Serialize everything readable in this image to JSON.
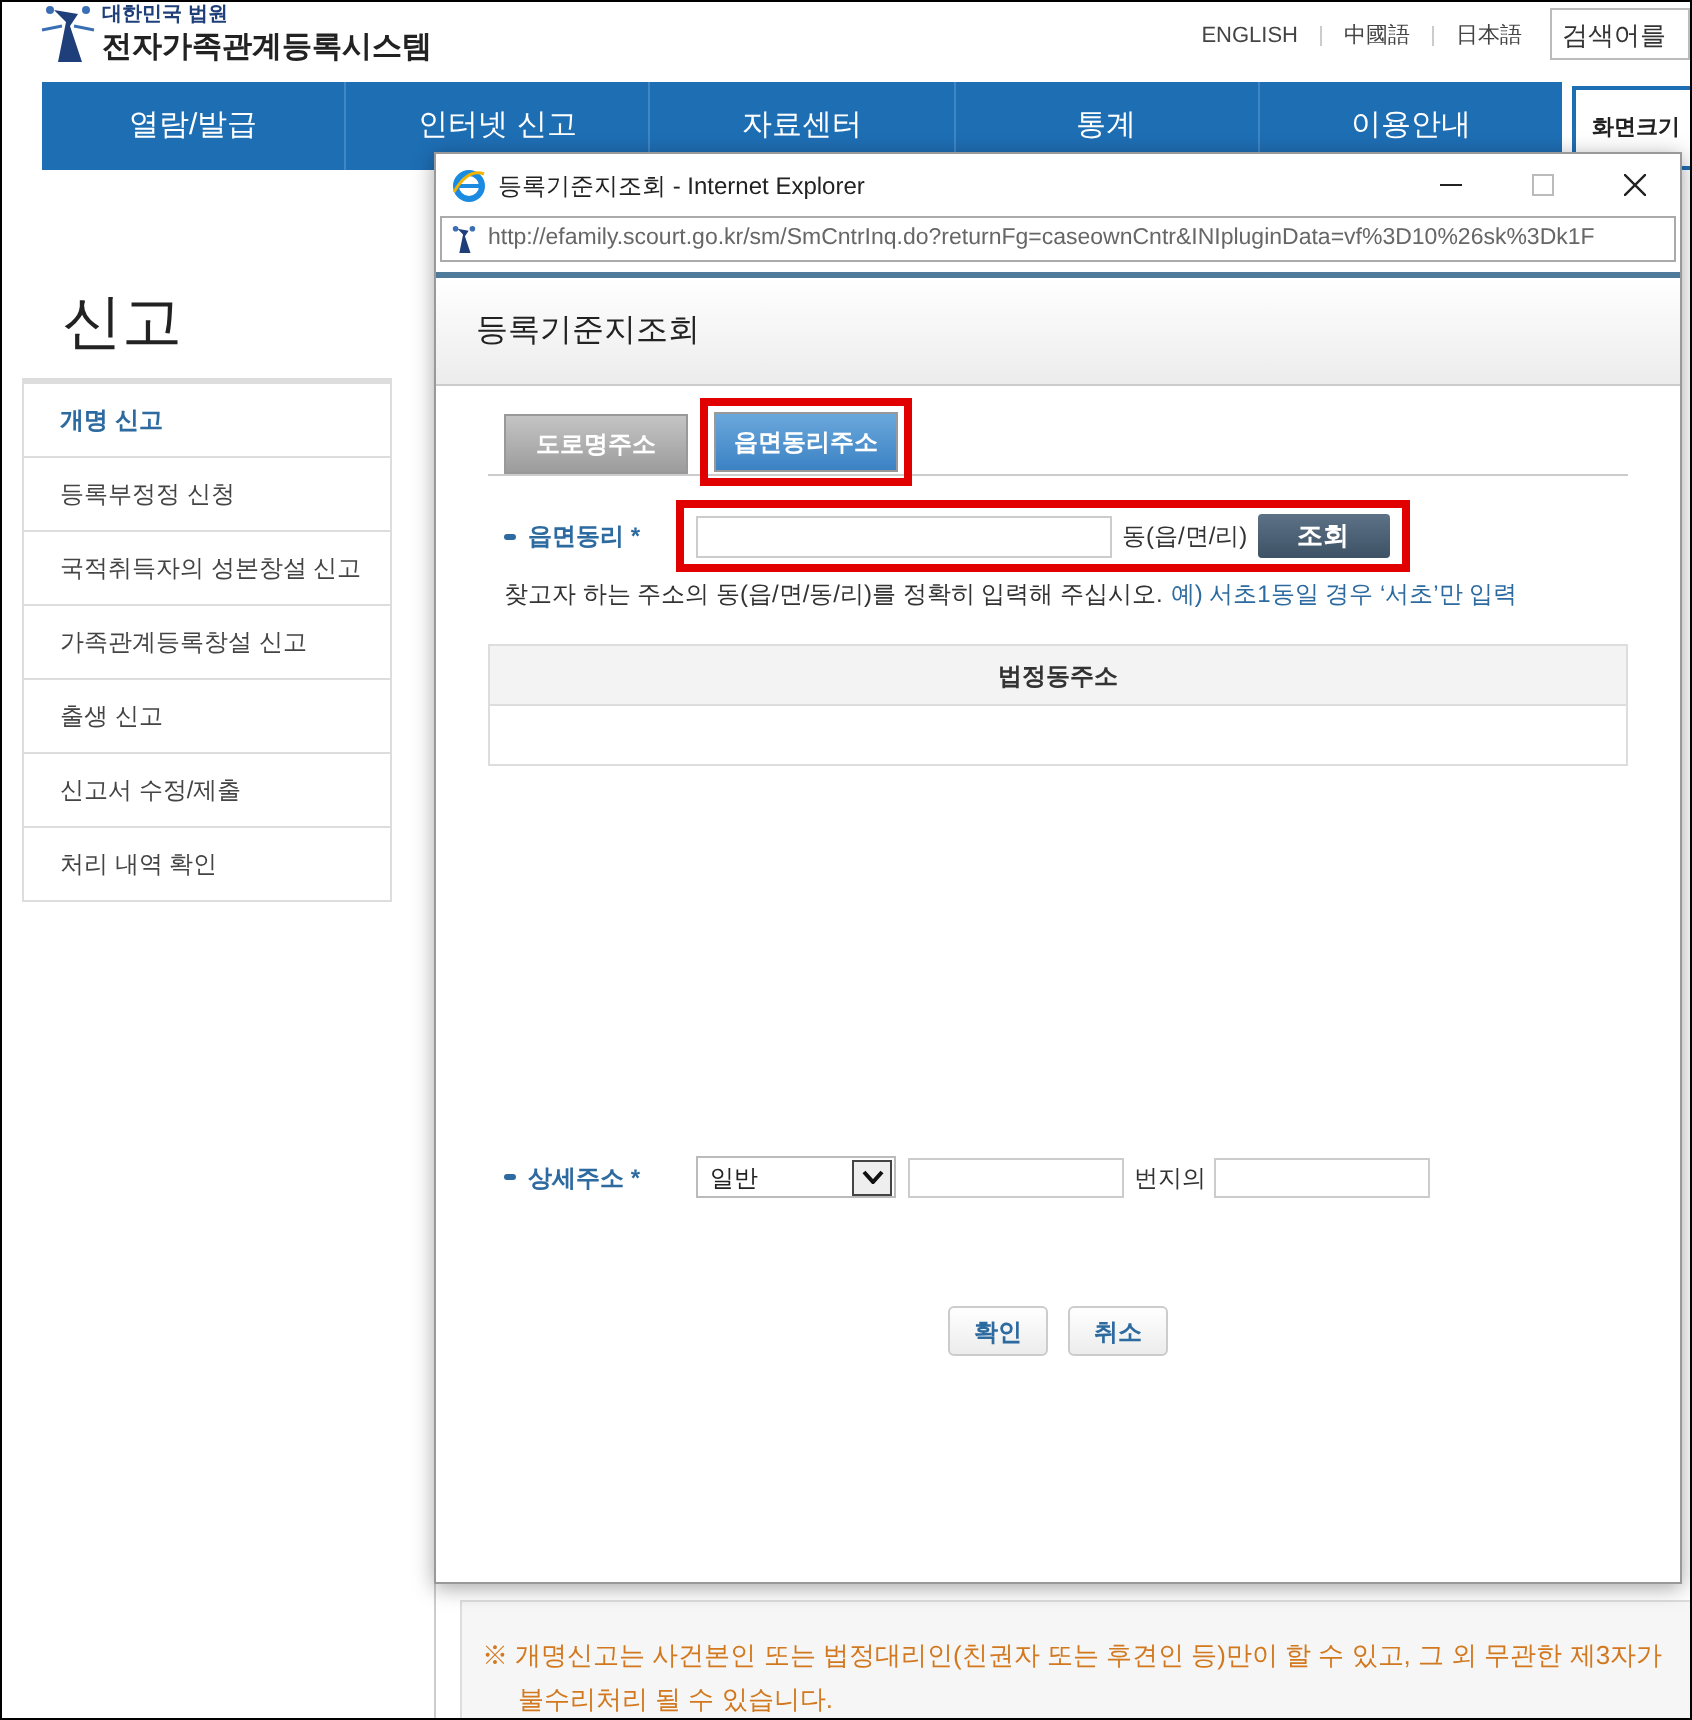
{
  "site": {
    "org": "대한민국 법원",
    "name": "전자가족관계등록시스템",
    "languages": [
      "ENGLISH",
      "中國語",
      "日本語"
    ],
    "search": {
      "placeholder": "검색어를"
    },
    "nav": [
      {
        "label": "열람/발급"
      },
      {
        "label": "인터넷 신고"
      },
      {
        "label": "자료센터"
      },
      {
        "label": "통계"
      },
      {
        "label": "이용안내"
      }
    ],
    "font_size_label": "화면크기",
    "section_title": "신고",
    "sidebar": {
      "items": [
        {
          "label": "개명 신고",
          "selected": true
        },
        {
          "label": "등록부정정 신청",
          "selected": false
        },
        {
          "label": "국적취득자의 성본창설 신고",
          "selected": false
        },
        {
          "label": "가족관계등록창설 신고",
          "selected": false
        },
        {
          "label": "출생 신고",
          "selected": false
        },
        {
          "label": "신고서 수정/제출",
          "selected": false
        },
        {
          "label": "처리 내역 확인",
          "selected": false
        }
      ]
    },
    "notice": [
      "※ 개명신고는 사건본인 또는 법정대리인(친권자 또는 후견인 등)만이 할 수 있고, 그 외 무관한 제3자가",
      "불수리처리 될 수 있습니다."
    ]
  },
  "popup": {
    "window": {
      "title": "등록기준지조회 - Internet Explorer",
      "url": "http://efamily.scourt.go.kr/sm/SmCntrInq.do?returnFg=caseownCntr&INIpluginData=vf%3D10%26sk%3Dk1F"
    },
    "heading": "등록기준지조회",
    "tabs": [
      {
        "label": "도로명주소",
        "selected": false,
        "highlighted": false
      },
      {
        "label": "읍면동리주소",
        "selected": true,
        "highlighted": true
      }
    ],
    "search_row": {
      "label": "읍면동리 *",
      "placeholder_suffix": "동(읍/면/리)",
      "button": "조회",
      "highlighted": true
    },
    "hint": {
      "text": "찾고자 하는 주소의 동(읍/면/동/리)를 정확히 입력해 주십시오.",
      "example": "예) 서초1동일 경우 ‘서초’만 입력"
    },
    "table": {
      "columns": [
        "법정동주소"
      ]
    },
    "detail_row": {
      "label": "상세주소 *",
      "select": "일반",
      "between": "번지의"
    },
    "buttons": [
      "확인",
      "취소"
    ]
  }
}
